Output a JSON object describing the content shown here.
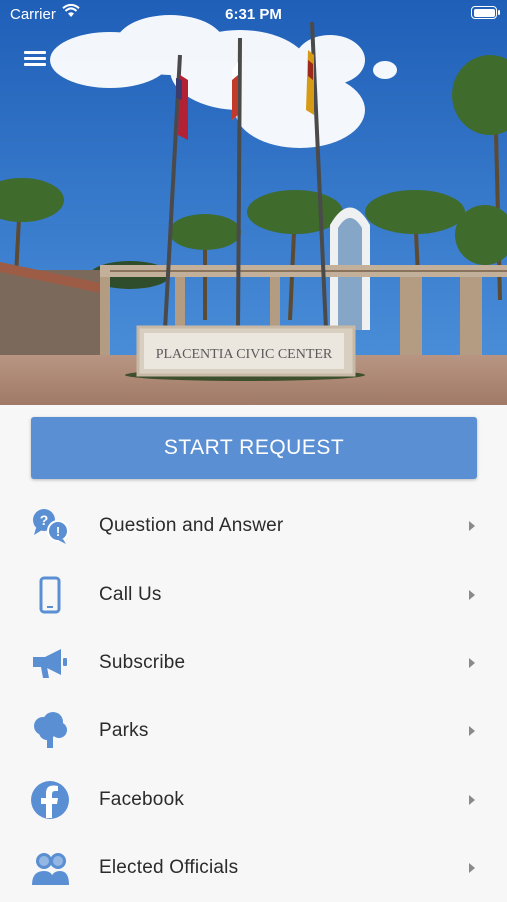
{
  "status_bar": {
    "carrier": "Carrier",
    "time": "6:31 PM"
  },
  "hero": {
    "sign_text": "PLACENTIA CIVIC CENTER"
  },
  "start_request": {
    "label": "START REQUEST"
  },
  "accent_color": "#5b8fd3",
  "menu": [
    {
      "label": "Question and Answer",
      "icon": "question-answer-icon"
    },
    {
      "label": "Call Us",
      "icon": "phone-icon"
    },
    {
      "label": "Subscribe",
      "icon": "megaphone-icon"
    },
    {
      "label": "Parks",
      "icon": "tree-icon"
    },
    {
      "label": "Facebook",
      "icon": "facebook-icon"
    },
    {
      "label": "Elected Officials",
      "icon": "officials-icon"
    }
  ]
}
